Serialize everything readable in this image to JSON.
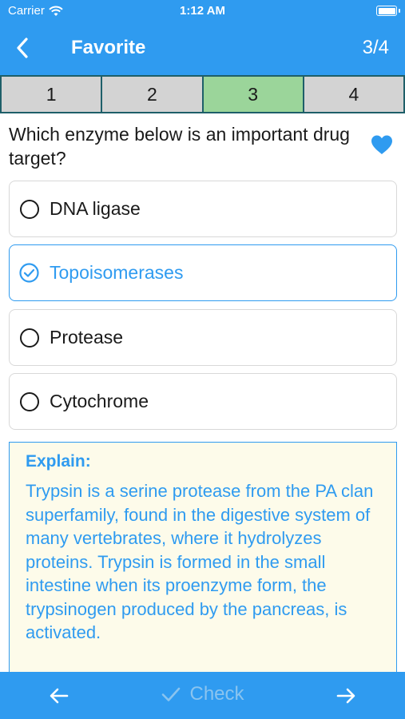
{
  "status_bar": {
    "carrier": "Carrier",
    "time": "1:12 AM"
  },
  "nav": {
    "title": "Favorite",
    "counter": "3/4"
  },
  "tabs": [
    {
      "label": "1",
      "active": false
    },
    {
      "label": "2",
      "active": false
    },
    {
      "label": "3",
      "active": true
    },
    {
      "label": "4",
      "active": false
    }
  ],
  "question": {
    "text": "Which enzyme below is an important drug target?",
    "favorited": true
  },
  "options": [
    {
      "label": "DNA ligase",
      "selected": false
    },
    {
      "label": "Topoisomerases",
      "selected": true
    },
    {
      "label": "Protease",
      "selected": false
    },
    {
      "label": "Cytochrome",
      "selected": false
    }
  ],
  "explain": {
    "heading": "Explain:",
    "text": "Trypsin is a serine protease from the PA clan superfamily, found in the digestive system of many vertebrates, where it hydrolyzes proteins. Trypsin is formed in the small intestine when its proenzyme form, the trypsinogen produced by the pancreas, is activated."
  },
  "footer": {
    "check_label": "Check"
  },
  "icons": {
    "back": "chevron-left-icon",
    "favorite": "heart-icon",
    "prev": "arrow-left-icon",
    "next": "arrow-right-icon",
    "check": "checkmark-icon",
    "selected": "check-circle-icon"
  },
  "colors": {
    "accent": "#2f9bf0",
    "active_tab": "#9bd59a",
    "tab": "#d3d3d3",
    "explain_bg": "#fdfbea"
  }
}
